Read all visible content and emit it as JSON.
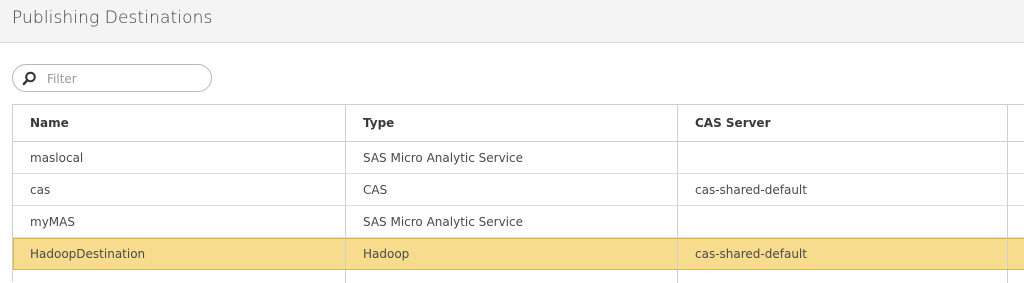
{
  "page": {
    "title": "Publishing Destinations"
  },
  "filter": {
    "placeholder": "Filter",
    "value": "",
    "icon": "search-icon"
  },
  "table": {
    "columns": [
      "Name",
      "Type",
      "CAS Server"
    ],
    "rows": [
      {
        "name": "maslocal",
        "type": "SAS Micro Analytic Service",
        "cas_server": "",
        "selected": false
      },
      {
        "name": "cas",
        "type": "CAS",
        "cas_server": "cas-shared-default",
        "selected": false
      },
      {
        "name": "myMAS",
        "type": "SAS Micro Analytic Service",
        "cas_server": "",
        "selected": false
      },
      {
        "name": "HadoopDestination",
        "type": "Hadoop",
        "cas_server": "cas-shared-default",
        "selected": true
      }
    ]
  },
  "colors": {
    "header_bg": "#f4f4f4",
    "selected_row": "#f7dc8e",
    "selected_border": "#d9b94f",
    "grid_line": "#cfcfcf"
  }
}
